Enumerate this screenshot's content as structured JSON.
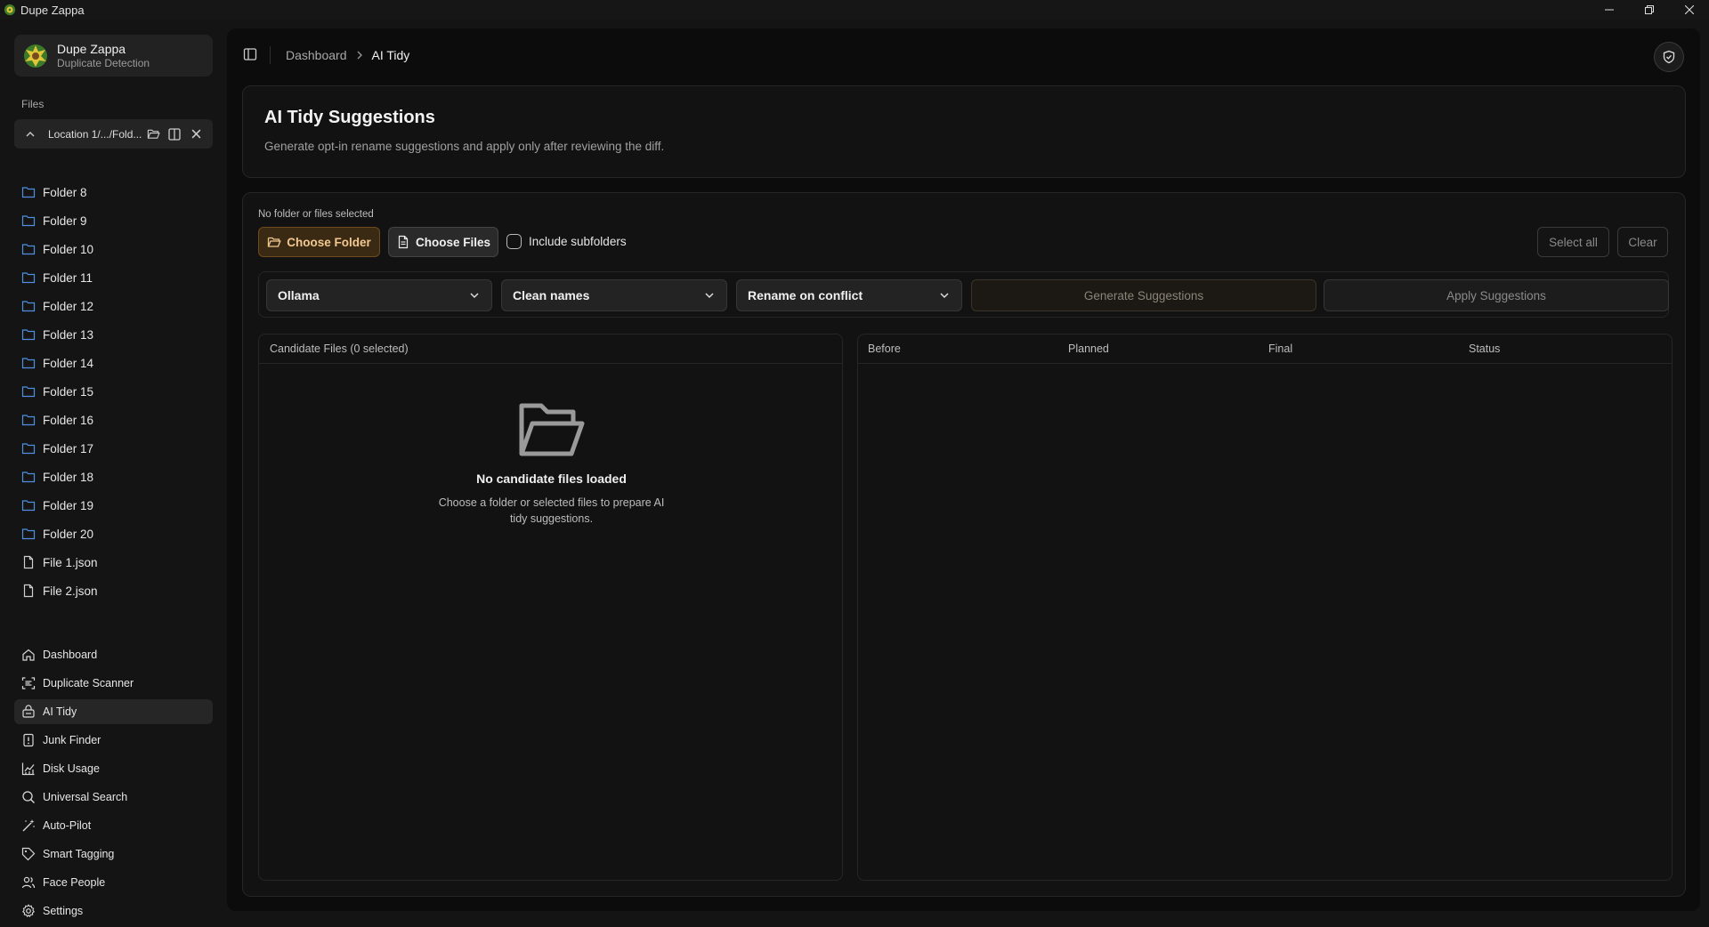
{
  "window": {
    "title": "Dupe Zappa"
  },
  "brand": {
    "name": "Dupe Zappa",
    "subtitle": "Duplicate Detection"
  },
  "sidebar": {
    "files_label": "Files",
    "location": "Location 1/.../Fold...",
    "tree": [
      {
        "label": "Folder 8",
        "icon": "folder-icon"
      },
      {
        "label": "Folder 9",
        "icon": "folder-icon"
      },
      {
        "label": "Folder 10",
        "icon": "folder-icon"
      },
      {
        "label": "Folder 11",
        "icon": "folder-icon"
      },
      {
        "label": "Folder 12",
        "icon": "folder-icon"
      },
      {
        "label": "Folder 13",
        "icon": "folder-icon"
      },
      {
        "label": "Folder 14",
        "icon": "folder-icon"
      },
      {
        "label": "Folder 15",
        "icon": "folder-icon"
      },
      {
        "label": "Folder 16",
        "icon": "folder-icon"
      },
      {
        "label": "Folder 17",
        "icon": "folder-icon"
      },
      {
        "label": "Folder 18",
        "icon": "folder-icon"
      },
      {
        "label": "Folder 19",
        "icon": "folder-icon"
      },
      {
        "label": "Folder 20",
        "icon": "folder-icon"
      },
      {
        "label": "File 1.json",
        "icon": "file-icon"
      },
      {
        "label": "File 2.json",
        "icon": "file-icon"
      }
    ],
    "nav": [
      {
        "label": "Dashboard",
        "icon": "home-icon"
      },
      {
        "label": "Duplicate Scanner",
        "icon": "scan-icon"
      },
      {
        "label": "AI Tidy",
        "icon": "tidy-icon",
        "active": true
      },
      {
        "label": "Junk Finder",
        "icon": "junk-icon"
      },
      {
        "label": "Disk Usage",
        "icon": "chart-icon"
      },
      {
        "label": "Universal Search",
        "icon": "search-icon"
      },
      {
        "label": "Auto-Pilot",
        "icon": "wand-icon"
      },
      {
        "label": "Smart Tagging",
        "icon": "tag-icon"
      },
      {
        "label": "Face People",
        "icon": "people-icon"
      },
      {
        "label": "Settings",
        "icon": "gear-icon"
      }
    ]
  },
  "breadcrumb": {
    "parent": "Dashboard",
    "current": "AI Tidy"
  },
  "header": {
    "title": "AI Tidy Suggestions",
    "description": "Generate opt-in rename suggestions and apply only after reviewing the diff."
  },
  "selection": {
    "status": "No folder or files selected",
    "choose_folder": "Choose Folder",
    "choose_files": "Choose Files",
    "include_subfolders": "Include subfolders",
    "select_all": "Select all",
    "clear": "Clear"
  },
  "controls": {
    "provider": "Ollama",
    "mode": "Clean names",
    "conflict": "Rename on conflict",
    "generate": "Generate Suggestions",
    "apply": "Apply Suggestions"
  },
  "candidates": {
    "header": "Candidate Files (0 selected)",
    "empty_title": "No candidate files loaded",
    "empty_desc": "Choose a folder or selected files to prepare AI tidy suggestions."
  },
  "results": {
    "columns": [
      "Before",
      "Planned",
      "Final",
      "Status"
    ]
  },
  "colors": {
    "accent": "#f2c890",
    "accent_bg": "#3a2a14",
    "background": "#0c0c0c"
  }
}
